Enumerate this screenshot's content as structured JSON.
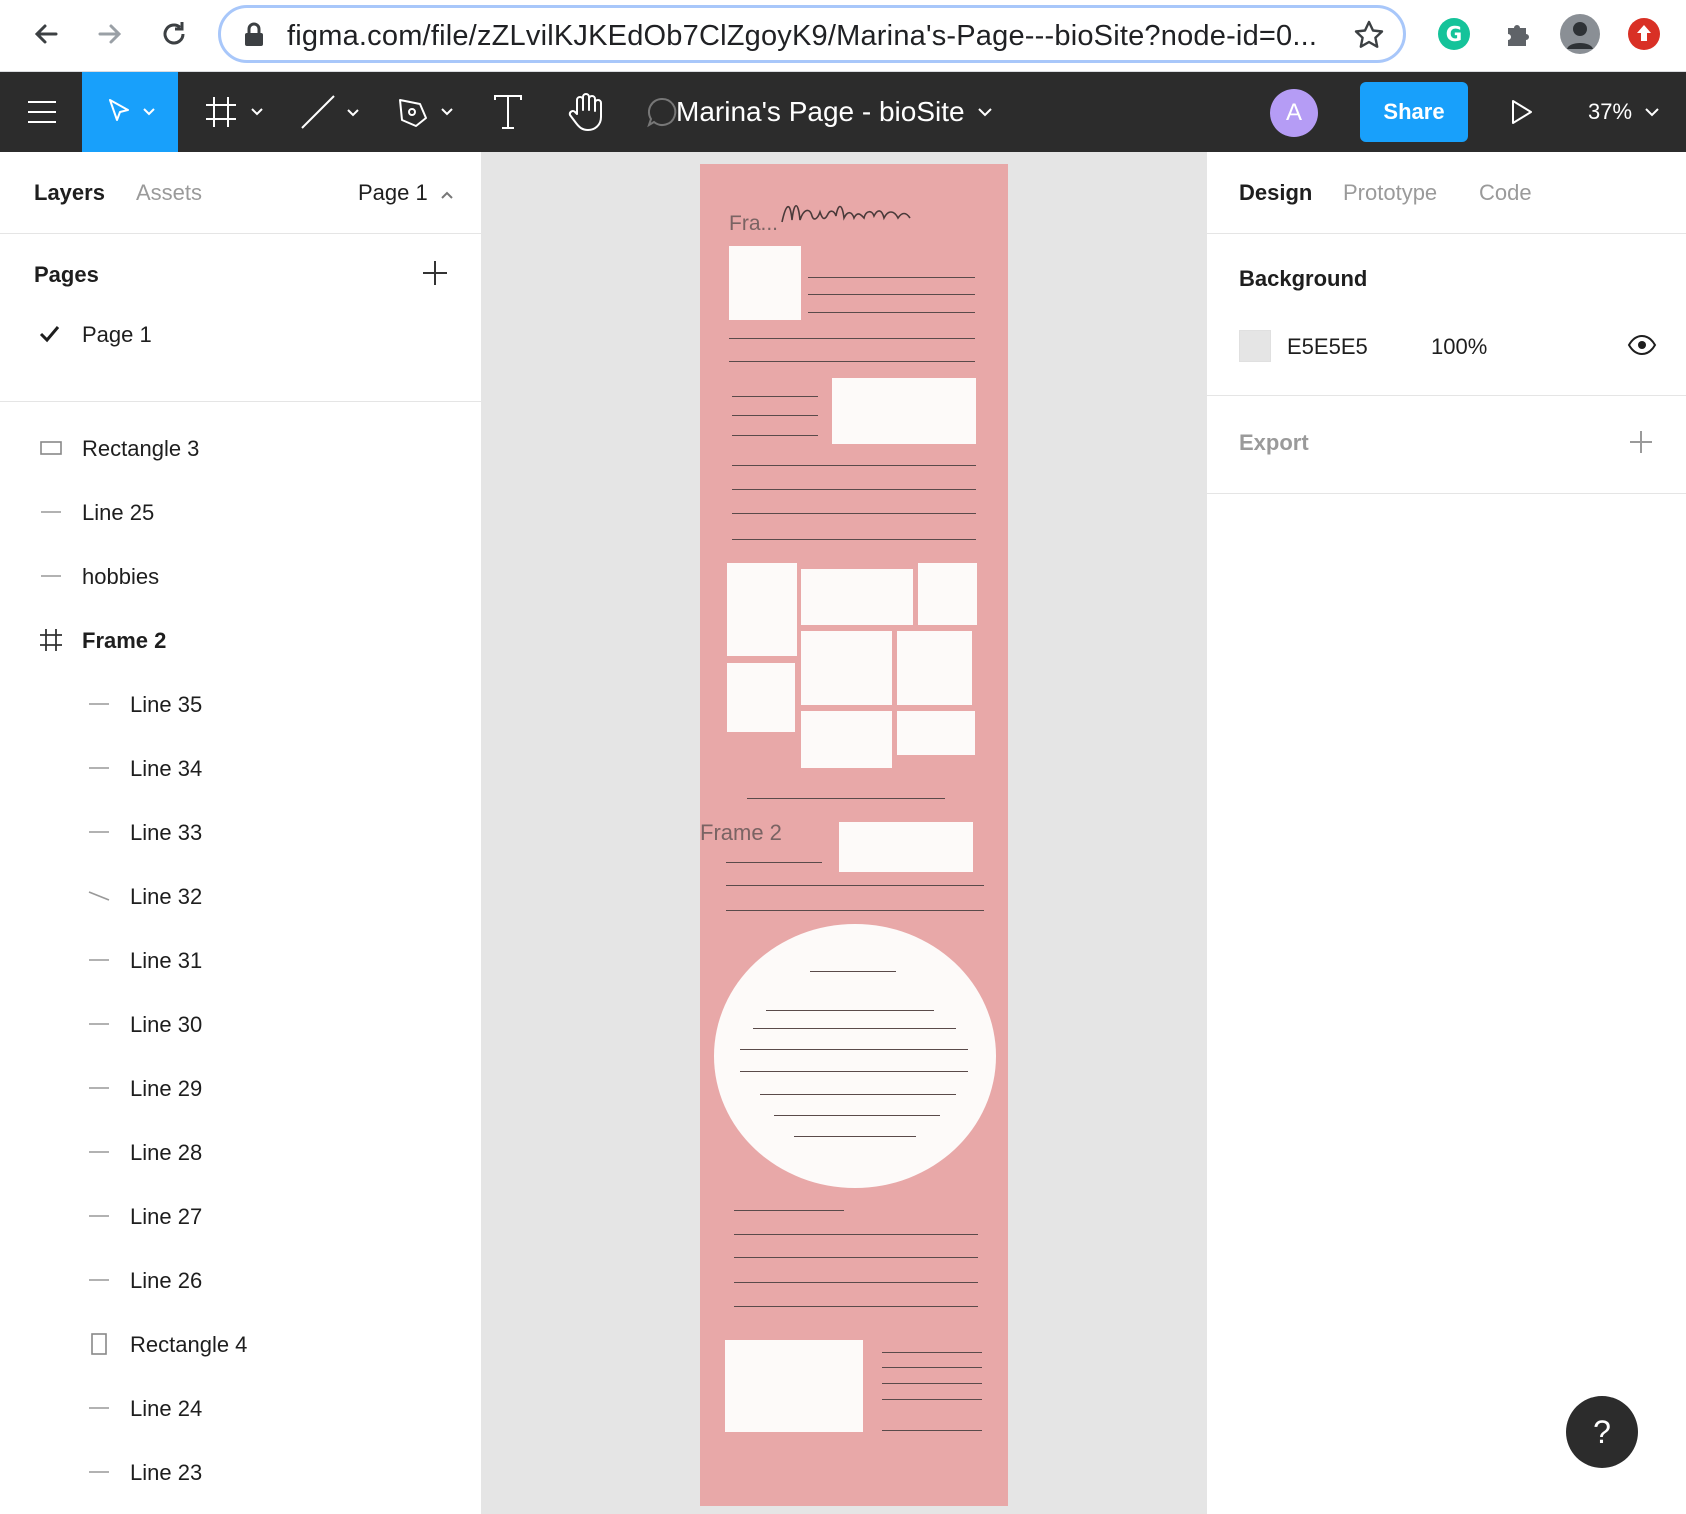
{
  "browser": {
    "url": "figma.com/file/zZLvilKJKEdOb7ClZgoyK9/Marina's-Page---bioSite?node-id=0...",
    "icons": [
      "back-icon",
      "forward-icon",
      "reload-icon",
      "lock-icon",
      "bookmark-star-icon",
      "grammarly-icon",
      "extensions-icon",
      "profile-avatar",
      "update-icon"
    ]
  },
  "toolbar": {
    "file_title": "Marina's Page - bioSite",
    "avatar_letter": "A",
    "share_label": "Share",
    "zoom_level": "37%",
    "tools": [
      "menu-icon",
      "move-tool",
      "frame-tool",
      "line-tool",
      "pen-tool",
      "text-tool",
      "hand-tool",
      "comment-icon",
      "present-icon"
    ]
  },
  "left_panel": {
    "tabs": {
      "layers": "Layers",
      "assets": "Assets",
      "page_selector": "Page 1"
    },
    "pages_heading": "Pages",
    "pages": [
      {
        "label": "Page 1",
        "active": true
      }
    ],
    "layers": [
      {
        "label": "Rectangle 3",
        "icon": "rectangle-icon",
        "indent": 0,
        "bold": false
      },
      {
        "label": "Line 25",
        "icon": "line-icon",
        "indent": 0,
        "bold": false
      },
      {
        "label": "hobbies",
        "icon": "line-icon",
        "indent": 0,
        "bold": false
      },
      {
        "label": "Frame 2",
        "icon": "frame-icon",
        "indent": 0,
        "bold": true
      },
      {
        "label": "Line 35",
        "icon": "line-icon",
        "indent": 1,
        "bold": false
      },
      {
        "label": "Line 34",
        "icon": "line-icon",
        "indent": 1,
        "bold": false
      },
      {
        "label": "Line 33",
        "icon": "line-icon",
        "indent": 1,
        "bold": false
      },
      {
        "label": "Line 32",
        "icon": "diagonal-line-icon",
        "indent": 1,
        "bold": false
      },
      {
        "label": "Line 31",
        "icon": "line-icon",
        "indent": 1,
        "bold": false
      },
      {
        "label": "Line 30",
        "icon": "line-icon",
        "indent": 1,
        "bold": false
      },
      {
        "label": "Line 29",
        "icon": "line-icon",
        "indent": 1,
        "bold": false
      },
      {
        "label": "Line 28",
        "icon": "line-icon",
        "indent": 1,
        "bold": false
      },
      {
        "label": "Line 27",
        "icon": "line-icon",
        "indent": 1,
        "bold": false
      },
      {
        "label": "Line 26",
        "icon": "line-icon",
        "indent": 1,
        "bold": false
      },
      {
        "label": "Rectangle 4",
        "icon": "rectangle-vertical-icon",
        "indent": 1,
        "bold": false
      },
      {
        "label": "Line 24",
        "icon": "line-icon",
        "indent": 1,
        "bold": false
      },
      {
        "label": "Line 23",
        "icon": "line-icon",
        "indent": 1,
        "bold": false
      }
    ]
  },
  "canvas": {
    "frame_label_top": "Fra...",
    "frame_label_mid": "Frame 2",
    "signature": "Marina",
    "frame_color": "#e8a8a8",
    "canvas_color": "#e5e5e5"
  },
  "right_panel": {
    "tabs": {
      "design": "Design",
      "prototype": "Prototype",
      "code": "Code"
    },
    "background_heading": "Background",
    "background_hex": "E5E5E5",
    "background_opacity": "100%",
    "export_heading": "Export"
  },
  "help_label": "?"
}
